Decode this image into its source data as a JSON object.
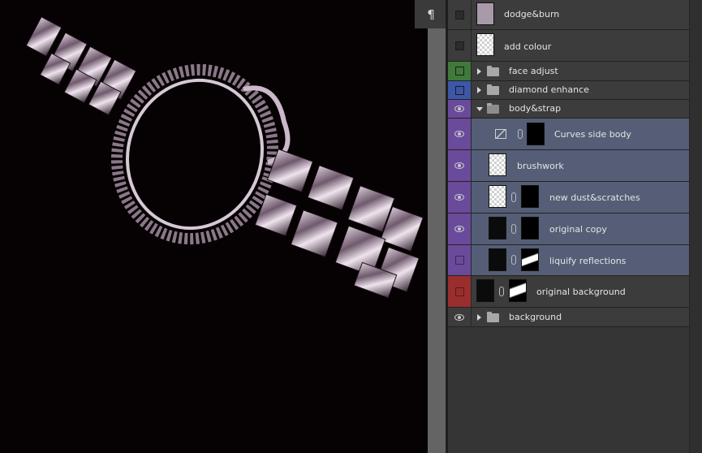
{
  "tool_strip": {
    "paragraph_icon": "¶"
  },
  "layers": [
    {
      "name": "dodge&burn",
      "visible": false,
      "color": "",
      "kind": "layer"
    },
    {
      "name": "add colour",
      "visible": false,
      "color": "",
      "kind": "layer"
    },
    {
      "name": "face adjust",
      "visible": false,
      "color": "#3f7a3a",
      "kind": "group",
      "expanded": false
    },
    {
      "name": "diamond enhance",
      "visible": false,
      "color": "#3c56a8",
      "kind": "group",
      "expanded": false
    },
    {
      "name": "body&strap",
      "visible": true,
      "color": "#6a4a9a",
      "kind": "group",
      "expanded": true
    },
    {
      "name": "Curves side body",
      "visible": true,
      "color": "#6a4a9a",
      "kind": "adjustment"
    },
    {
      "name": "brushwork",
      "visible": true,
      "color": "#6a4a9a",
      "kind": "layer"
    },
    {
      "name": "new dust&scratches",
      "visible": true,
      "color": "#6a4a9a",
      "kind": "layer"
    },
    {
      "name": "original copy",
      "visible": true,
      "color": "#6a4a9a",
      "kind": "layer"
    },
    {
      "name": "liquify reflections",
      "visible": false,
      "color": "#6a4a9a",
      "kind": "layer"
    },
    {
      "name": "original background",
      "visible": false,
      "color": "#9a2d2d",
      "kind": "layer"
    },
    {
      "name": "background",
      "visible": true,
      "color": "",
      "kind": "group",
      "expanded": false
    }
  ]
}
